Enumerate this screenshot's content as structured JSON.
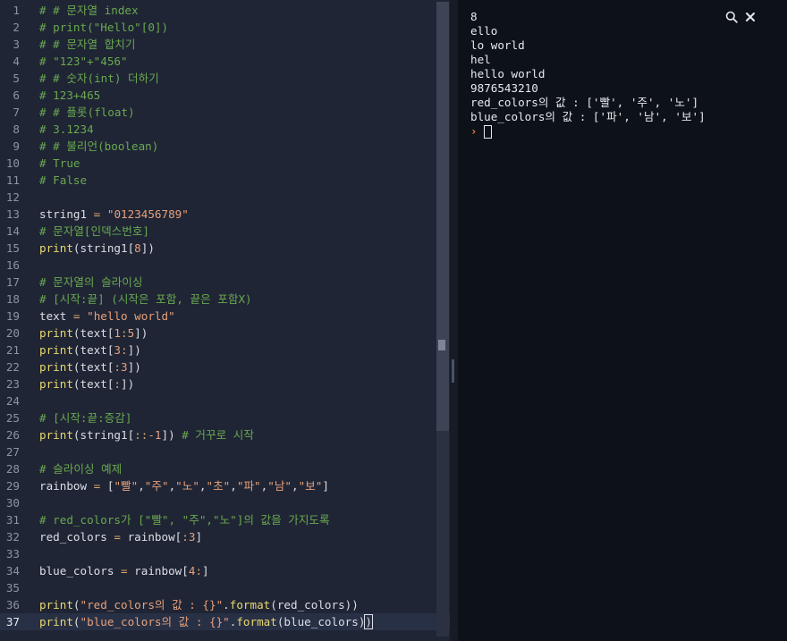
{
  "editor": {
    "active_line": 37,
    "lines": [
      {
        "n": "1",
        "tokens": [
          {
            "t": "# # 문자열 index",
            "c": "comment"
          }
        ]
      },
      {
        "n": "2",
        "tokens": [
          {
            "t": "# print(\"Hello\"[0])",
            "c": "comment"
          }
        ]
      },
      {
        "n": "3",
        "tokens": [
          {
            "t": "# # 문자열 합치기",
            "c": "comment"
          }
        ]
      },
      {
        "n": "4",
        "tokens": [
          {
            "t": "# \"123\"+\"456\"",
            "c": "comment"
          }
        ]
      },
      {
        "n": "5",
        "tokens": [
          {
            "t": "# # 숫자(int) 더하기",
            "c": "comment"
          }
        ]
      },
      {
        "n": "6",
        "tokens": [
          {
            "t": "# 123+465",
            "c": "comment"
          }
        ]
      },
      {
        "n": "7",
        "tokens": [
          {
            "t": "# # 플롯(float)",
            "c": "comment"
          }
        ]
      },
      {
        "n": "8",
        "tokens": [
          {
            "t": "# 3.1234",
            "c": "comment"
          }
        ]
      },
      {
        "n": "9",
        "tokens": [
          {
            "t": "# # 불리언(boolean)",
            "c": "comment"
          }
        ]
      },
      {
        "n": "10",
        "tokens": [
          {
            "t": "# True",
            "c": "comment"
          }
        ]
      },
      {
        "n": "11",
        "tokens": [
          {
            "t": "# False",
            "c": "comment"
          }
        ]
      },
      {
        "n": "12",
        "tokens": []
      },
      {
        "n": "13",
        "tokens": [
          {
            "t": "string1 ",
            "c": "plain"
          },
          {
            "t": "=",
            "c": "op"
          },
          {
            "t": " ",
            "c": "plain"
          },
          {
            "t": "\"0123456789\"",
            "c": "string"
          }
        ]
      },
      {
        "n": "14",
        "tokens": [
          {
            "t": "# 문자열[인덱스번호]",
            "c": "comment"
          }
        ]
      },
      {
        "n": "15",
        "tokens": [
          {
            "t": "print",
            "c": "kw"
          },
          {
            "t": "(string1[",
            "c": "plain"
          },
          {
            "t": "8",
            "c": "num"
          },
          {
            "t": "])",
            "c": "plain"
          }
        ]
      },
      {
        "n": "16",
        "tokens": []
      },
      {
        "n": "17",
        "tokens": [
          {
            "t": "# 문자열의 슬라이싱",
            "c": "comment"
          }
        ]
      },
      {
        "n": "18",
        "tokens": [
          {
            "t": "# [시작:끝] (시작은 포함, 끝은 포함X)",
            "c": "comment"
          }
        ]
      },
      {
        "n": "19",
        "tokens": [
          {
            "t": "text ",
            "c": "plain"
          },
          {
            "t": "=",
            "c": "op"
          },
          {
            "t": " ",
            "c": "plain"
          },
          {
            "t": "\"hello world\"",
            "c": "string"
          }
        ]
      },
      {
        "n": "20",
        "tokens": [
          {
            "t": "print",
            "c": "kw"
          },
          {
            "t": "(text[",
            "c": "plain"
          },
          {
            "t": "1",
            "c": "num"
          },
          {
            "t": ":",
            "c": "op"
          },
          {
            "t": "5",
            "c": "num"
          },
          {
            "t": "])",
            "c": "plain"
          }
        ]
      },
      {
        "n": "21",
        "tokens": [
          {
            "t": "print",
            "c": "kw"
          },
          {
            "t": "(text[",
            "c": "plain"
          },
          {
            "t": "3",
            "c": "num"
          },
          {
            "t": ":",
            "c": "op"
          },
          {
            "t": "])",
            "c": "plain"
          }
        ]
      },
      {
        "n": "22",
        "tokens": [
          {
            "t": "print",
            "c": "kw"
          },
          {
            "t": "(text[",
            "c": "plain"
          },
          {
            "t": ":",
            "c": "op"
          },
          {
            "t": "3",
            "c": "num"
          },
          {
            "t": "])",
            "c": "plain"
          }
        ]
      },
      {
        "n": "23",
        "tokens": [
          {
            "t": "print",
            "c": "kw"
          },
          {
            "t": "(text[",
            "c": "plain"
          },
          {
            "t": ":",
            "c": "op"
          },
          {
            "t": "])",
            "c": "plain"
          }
        ]
      },
      {
        "n": "24",
        "tokens": []
      },
      {
        "n": "25",
        "tokens": [
          {
            "t": "# [시작:끝:증감]",
            "c": "comment"
          }
        ]
      },
      {
        "n": "26",
        "tokens": [
          {
            "t": "print",
            "c": "kw"
          },
          {
            "t": "(string1[",
            "c": "plain"
          },
          {
            "t": "::",
            "c": "op"
          },
          {
            "t": "-1",
            "c": "num"
          },
          {
            "t": "]) ",
            "c": "plain"
          },
          {
            "t": "# 거꾸로 시작",
            "c": "comment"
          }
        ]
      },
      {
        "n": "27",
        "tokens": []
      },
      {
        "n": "28",
        "tokens": [
          {
            "t": "# 슬라이싱 예제",
            "c": "comment"
          }
        ]
      },
      {
        "n": "29",
        "tokens": [
          {
            "t": "rainbow ",
            "c": "plain"
          },
          {
            "t": "=",
            "c": "op"
          },
          {
            "t": " [",
            "c": "plain"
          },
          {
            "t": "\"빨\"",
            "c": "string"
          },
          {
            "t": ",",
            "c": "plain"
          },
          {
            "t": "\"주\"",
            "c": "string"
          },
          {
            "t": ",",
            "c": "plain"
          },
          {
            "t": "\"노\"",
            "c": "string"
          },
          {
            "t": ",",
            "c": "plain"
          },
          {
            "t": "\"초\"",
            "c": "string"
          },
          {
            "t": ",",
            "c": "plain"
          },
          {
            "t": "\"파\"",
            "c": "string"
          },
          {
            "t": ",",
            "c": "plain"
          },
          {
            "t": "\"남\"",
            "c": "string"
          },
          {
            "t": ",",
            "c": "plain"
          },
          {
            "t": "\"보\"",
            "c": "string"
          },
          {
            "t": "]",
            "c": "plain"
          }
        ]
      },
      {
        "n": "30",
        "tokens": []
      },
      {
        "n": "31",
        "tokens": [
          {
            "t": "# red_colors가 [\"빨\", \"주\",\"노\"]의 값을 가지도록",
            "c": "comment"
          }
        ]
      },
      {
        "n": "32",
        "tokens": [
          {
            "t": "red_colors ",
            "c": "plain"
          },
          {
            "t": "=",
            "c": "op"
          },
          {
            "t": " rainbow[",
            "c": "plain"
          },
          {
            "t": ":",
            "c": "op"
          },
          {
            "t": "3",
            "c": "num"
          },
          {
            "t": "]",
            "c": "plain"
          }
        ]
      },
      {
        "n": "33",
        "tokens": []
      },
      {
        "n": "34",
        "tokens": [
          {
            "t": "blue_colors ",
            "c": "plain"
          },
          {
            "t": "=",
            "c": "op"
          },
          {
            "t": " rainbow[",
            "c": "plain"
          },
          {
            "t": "4",
            "c": "num"
          },
          {
            "t": ":",
            "c": "op"
          },
          {
            "t": "]",
            "c": "plain"
          }
        ]
      },
      {
        "n": "35",
        "tokens": []
      },
      {
        "n": "36",
        "tokens": [
          {
            "t": "print",
            "c": "kw"
          },
          {
            "t": "(",
            "c": "plain"
          },
          {
            "t": "\"red_colors의 값 : {}\"",
            "c": "string"
          },
          {
            "t": ".",
            "c": "plain"
          },
          {
            "t": "format",
            "c": "kw"
          },
          {
            "t": "(red_colors))",
            "c": "plain"
          }
        ]
      },
      {
        "n": "37",
        "tokens": [
          {
            "t": "print",
            "c": "kw"
          },
          {
            "t": "(",
            "c": "plain"
          },
          {
            "t": "\"blue_colors의 값 : {}\"",
            "c": "string"
          },
          {
            "t": ".",
            "c": "plain"
          },
          {
            "t": "format",
            "c": "kw"
          },
          {
            "t": "(blue_colors)",
            "c": "plain"
          },
          {
            "t": ")",
            "c": "cursor"
          }
        ]
      }
    ]
  },
  "console": {
    "output": [
      "8",
      "ello",
      "lo world",
      "hel",
      "hello world",
      "9876543210",
      "red_colors의 값 : ['빨', '주', '노']",
      "blue_colors의 값 : ['파', '남', '보']"
    ],
    "prompt_symbol": "›",
    "search_icon": "search-icon",
    "close_icon": "close-icon"
  },
  "colors": {
    "editor_bg": "#1f2535",
    "console_bg": "#0d1118",
    "comment": "#6aa84f",
    "string": "#e7a07a",
    "keyword": "#e9d86f",
    "prompt": "#e8803a"
  }
}
